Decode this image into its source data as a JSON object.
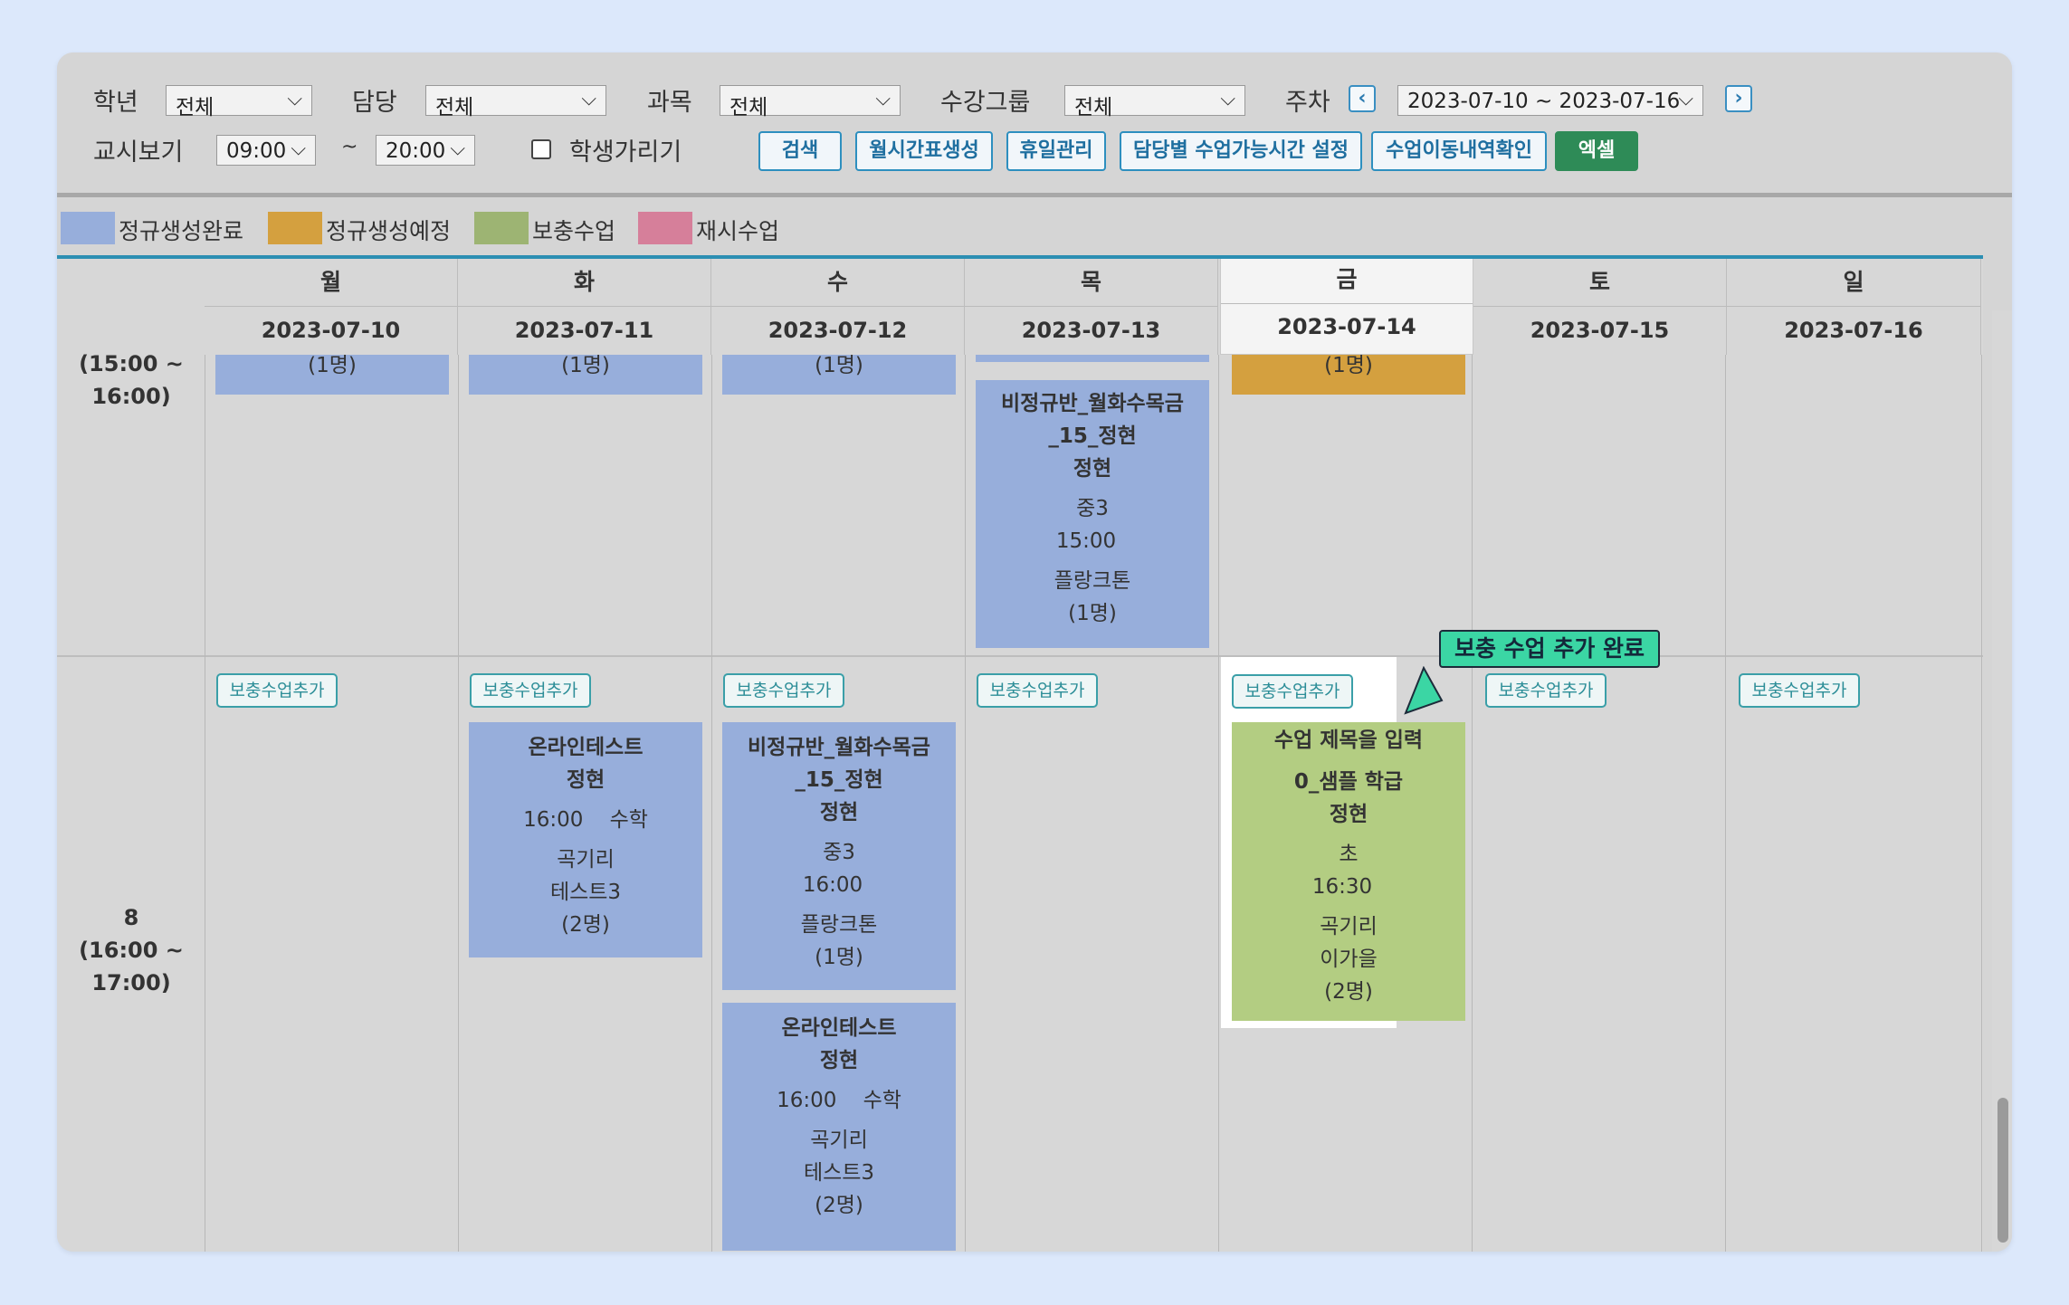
{
  "filters": {
    "grade": {
      "label": "학년",
      "value": "전체"
    },
    "teacher": {
      "label": "담당",
      "value": "전체"
    },
    "subject": {
      "label": "과목",
      "value": "전체"
    },
    "group": {
      "label": "수강그룹",
      "value": "전체"
    },
    "week": {
      "label": "주차",
      "value": "2023-07-10 ~ 2023-07-16"
    },
    "period_view": {
      "label": "교시보기",
      "start": "09:00",
      "sep": "~",
      "end": "20:00"
    },
    "hide_students": {
      "label": "학생가리기",
      "checked": false
    }
  },
  "buttons": {
    "search": "검색",
    "monthly": "월시간표생성",
    "holiday": "휴일관리",
    "teacher_time": "담당별 수업가능시간 설정",
    "move_history": "수업이동내역확인",
    "excel": "엑셀"
  },
  "legend": [
    {
      "label": "정규생성완료",
      "color": "#97aedb"
    },
    {
      "label": "정규생성예정",
      "color": "#d4a03f"
    },
    {
      "label": "보충수업",
      "color": "#9db473"
    },
    {
      "label": "재시수업",
      "color": "#d67f9a"
    }
  ],
  "days": [
    {
      "day": "월",
      "date": "2023-07-10"
    },
    {
      "day": "화",
      "date": "2023-07-11"
    },
    {
      "day": "수",
      "date": "2023-07-12"
    },
    {
      "day": "목",
      "date": "2023-07-13"
    },
    {
      "day": "금",
      "date": "2023-07-14"
    },
    {
      "day": "토",
      "date": "2023-07-15"
    },
    {
      "day": "일",
      "date": "2023-07-16"
    }
  ],
  "periods": {
    "p7": {
      "line1": "(15:00 ~",
      "line2": "16:00)"
    },
    "p8": {
      "num": "8",
      "line1": "(16:00 ~",
      "line2": "17:00)"
    }
  },
  "row7": {
    "count_label": "(1명)",
    "thu_block": {
      "title1": "비정규반_월화수목금",
      "title2": "_15_정현",
      "teacher": "정현",
      "grade": "중3",
      "time": "15:00",
      "room": "플랑크톤",
      "count": "(1명)"
    }
  },
  "row8": {
    "add_label": "보충수업추가",
    "tue_block": {
      "title": "온라인테스트",
      "teacher": "정현",
      "time_subject": "16:00    수학",
      "room": "곡기리",
      "student": "테스트3",
      "count": "(2명)"
    },
    "wed_block1": {
      "title1": "비정규반_월화수목금",
      "title2": "_15_정현",
      "teacher": "정현",
      "grade": "중3",
      "time": "16:00",
      "room": "플랑크톤",
      "count": "(1명)"
    },
    "wed_block2": {
      "title": "온라인테스트",
      "teacher": "정현",
      "time_subject": "16:00    수학",
      "room": "곡기리",
      "student": "테스트3",
      "count": "(2명)"
    },
    "fri_block": {
      "title": "수업 제목을 입력",
      "class": "0_샘플 학급",
      "teacher": "정현",
      "grade": "초",
      "time": "16:30",
      "room": "곡기리",
      "student": "이가을",
      "count": "(2명)"
    }
  },
  "callout": "보충 수업 추가 완료"
}
